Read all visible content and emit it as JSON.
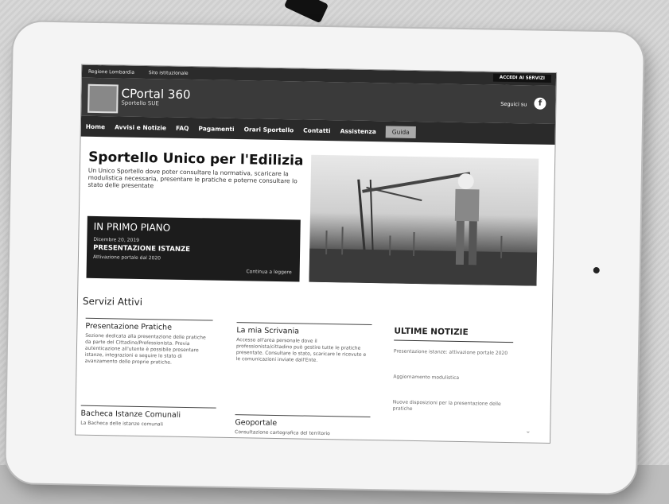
{
  "topbar": {
    "link1": "Regione Lombardia",
    "link2": "Sito istituzionale",
    "access": "ACCEDI AI SERVIZI"
  },
  "brand": {
    "title": "CPortal 360",
    "subtitle": "Sportello SUE",
    "follow": "Seguici su",
    "fb": "f"
  },
  "nav": [
    "Home",
    "Avvisi e Notizie",
    "FAQ",
    "Pagamenti",
    "Orari Sportello",
    "Contatti",
    "Assistenza",
    "Guida"
  ],
  "hero": {
    "title": "Sportello Unico per l'Edilizia",
    "description": "Un Unico Sportello dove poter consultare la normativa, scaricare la modulistica necessaria, presentare le pratiche e poterne consultare lo stato delle presentate"
  },
  "promo": {
    "title": "IN PRIMO PIANO",
    "date": "Dicembre 20, 2019",
    "headline": "PRESENTAZIONE ISTANZE",
    "subtitle": "Attivazione portale dal 2020",
    "link": "Continua a leggere"
  },
  "services": {
    "title": "Servizi Attivi",
    "cards": [
      {
        "title": "Presentazione Pratiche",
        "text": "Sezione dedicata alla presentazione delle pratiche da parte del Cittadino/Professionista. Previa autenticazione all'utente è possibile presentare istanze, integrazioni e seguire lo stato di avanzamento delle proprie pratiche."
      },
      {
        "title": "La mia Scrivania",
        "text": "Accesso all'area personale dove il professionista/cittadino può gestire tutte le pratiche presentate. Consultare lo stato, scaricare le ricevute e le comunicazioni inviate dall'Ente."
      },
      {
        "title": "Bacheca Istanze Comunali",
        "text": "La Bacheca delle istanze comunali"
      },
      {
        "title": "Geoportale",
        "text": "Consultazione cartografica del territorio"
      }
    ]
  },
  "news": {
    "title": "ULTIME NOTIZIE",
    "items": [
      "Presentazione istanze: attivazione portale 2020",
      "Aggiornamento modulistica",
      "Nuove disposizioni per la presentazione delle pratiche"
    ]
  },
  "scroll_icon": "chevron-down-icon",
  "colors": {
    "header": "#3a3a3a",
    "nav": "#2a2a2a",
    "promo": "#1c1c1c"
  }
}
